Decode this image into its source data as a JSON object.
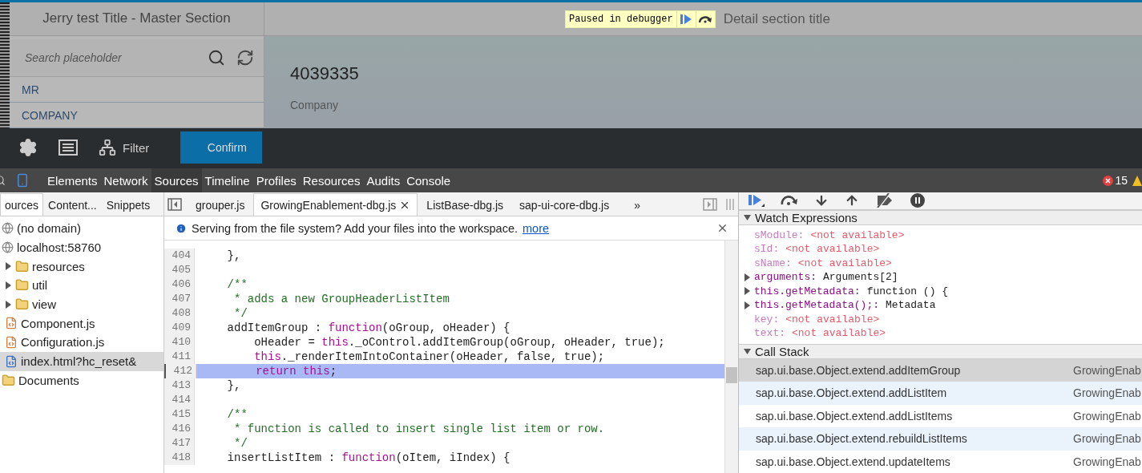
{
  "app": {
    "master_title": "Jerry test Title - Master Section",
    "debugger_badge": {
      "text": "Paused in debugger"
    },
    "detail_title": "Detail section title",
    "search": {
      "placeholder": "Search placeholder"
    },
    "master_items": [
      {
        "label": "MR"
      },
      {
        "label": "COMPANY"
      }
    ],
    "detail": {
      "number": "4039335",
      "label": "Company"
    }
  },
  "footer_toolbar": {
    "filter_label": "Filter",
    "confirm_label": "Confirm"
  },
  "devtools": {
    "tabs": [
      {
        "label": "Elements",
        "selected": false
      },
      {
        "label": "Network",
        "selected": false
      },
      {
        "label": "Sources",
        "selected": true
      },
      {
        "label": "Timeline",
        "selected": false
      },
      {
        "label": "Profiles",
        "selected": false
      },
      {
        "label": "Resources",
        "selected": false
      },
      {
        "label": "Audits",
        "selected": false
      },
      {
        "label": "Console",
        "selected": false
      }
    ],
    "error_count": "15",
    "navigator_tabs": [
      {
        "label": "ources",
        "selected": true
      },
      {
        "label": "Content...",
        "selected": false
      },
      {
        "label": "Snippets",
        "selected": false
      }
    ],
    "file_tree": [
      {
        "label": "(no domain)",
        "kind": "domain"
      },
      {
        "label": "localhost:58760",
        "kind": "domain",
        "children": [
          {
            "label": "resources",
            "kind": "folder",
            "expanded": false
          },
          {
            "label": "util",
            "kind": "folder",
            "expanded": false
          },
          {
            "label": "view",
            "kind": "folder",
            "expanded": false
          },
          {
            "label": "Component.js",
            "kind": "script"
          },
          {
            "label": "Configuration.js",
            "kind": "script"
          },
          {
            "label": "index.html?hc_reset&",
            "kind": "page",
            "selected": true
          }
        ]
      },
      {
        "label": "Documents",
        "kind": "folder"
      }
    ],
    "editor_tabs": [
      {
        "label": "grouper.js",
        "selected": false
      },
      {
        "label": "GrowingEnablement-dbg.js",
        "selected": true
      },
      {
        "label": "ListBase-dbg.js",
        "selected": false
      },
      {
        "label": "sap-ui-core-dbg.js",
        "selected": false
      }
    ],
    "more_tabs": "»",
    "info_bar": {
      "text": "Serving from the file system? Add your files into the workspace.",
      "link": "more"
    },
    "code_lines": [
      {
        "number": "404",
        "tokens": [
          {
            "kind": "plain",
            "text": "    },"
          }
        ]
      },
      {
        "number": "405"
      },
      {
        "number": "406",
        "tokens": [
          {
            "kind": "comment",
            "text": "    /**"
          }
        ]
      },
      {
        "number": "407",
        "tokens": [
          {
            "kind": "comment",
            "text": "     * adds a new GroupHeaderListItem"
          }
        ]
      },
      {
        "number": "408",
        "tokens": [
          {
            "kind": "comment",
            "text": "     */"
          }
        ]
      },
      {
        "number": "409",
        "tokens": [
          {
            "kind": "plain",
            "text": "    addItemGroup : "
          },
          {
            "kind": "keyword",
            "text": "function"
          },
          {
            "kind": "plain",
            "text": "(oGroup, oHeader) {"
          }
        ]
      },
      {
        "number": "410",
        "tokens": [
          {
            "kind": "plain",
            "text": "        oHeader = "
          },
          {
            "kind": "keyword",
            "text": "this"
          },
          {
            "kind": "plain",
            "text": "._oControl.addItemGroup(oGroup, oHeader, true);"
          }
        ]
      },
      {
        "number": "411",
        "tokens": [
          {
            "kind": "keyword",
            "text": "        this"
          },
          {
            "kind": "plain",
            "text": "._renderItemIntoContainer(oHeader, false, true);"
          }
        ]
      },
      {
        "number": "412",
        "highlighted": true,
        "tokens": [
          {
            "kind": "keyword",
            "text": "        return this"
          },
          {
            "kind": "plain",
            "text": ";"
          }
        ]
      },
      {
        "number": "413",
        "tokens": [
          {
            "kind": "plain",
            "text": "    },"
          }
        ]
      },
      {
        "number": "414"
      },
      {
        "number": "415",
        "tokens": [
          {
            "kind": "comment",
            "text": "    /**"
          }
        ]
      },
      {
        "number": "416",
        "tokens": [
          {
            "kind": "comment",
            "text": "     * function is called to insert single list item or row."
          }
        ]
      },
      {
        "number": "417",
        "tokens": [
          {
            "kind": "comment",
            "text": "     */"
          }
        ]
      },
      {
        "number": "418",
        "tokens": [
          {
            "kind": "plain",
            "text": "    insertListItem : "
          },
          {
            "kind": "keyword",
            "text": "function"
          },
          {
            "kind": "plain",
            "text": "(oItem, iIndex) {"
          }
        ]
      }
    ],
    "watch_expressions": {
      "title": "Watch Expressions",
      "items": [
        {
          "name": "sModule:",
          "value": "<not available>",
          "available": false
        },
        {
          "name": "sId:",
          "value": "<not available>",
          "available": false
        },
        {
          "name": "sName:",
          "value": "<not available>",
          "available": false
        },
        {
          "name": "arguments:",
          "value": "Arguments[2]",
          "available": true
        },
        {
          "name": "this.getMetadata:",
          "value": "function () {",
          "available": true
        },
        {
          "name": "this.getMetadata();:",
          "value": "Metadata",
          "available": true
        },
        {
          "name": "key:",
          "value": "<not available>",
          "available": false
        },
        {
          "name": "text:",
          "value": "<not available>",
          "available": false
        }
      ]
    },
    "call_stack": {
      "title": "Call Stack",
      "frames": [
        {
          "function": "sap.ui.base.Object.extend.addItemGroup",
          "file": "GrowingEnab",
          "selected": true
        },
        {
          "function": "sap.ui.base.Object.extend.addListItem",
          "file": "GrowingEnab",
          "selected": false
        },
        {
          "function": "sap.ui.base.Object.extend.addListItems",
          "file": "GrowingEnab",
          "selected": false
        },
        {
          "function": "sap.ui.base.Object.extend.rebuildListItems",
          "file": "GrowingEnab",
          "selected": false
        },
        {
          "function": "sap.ui.base.Object.extend.updateItems",
          "file": "GrowingEnab",
          "selected": false
        }
      ]
    }
  }
}
